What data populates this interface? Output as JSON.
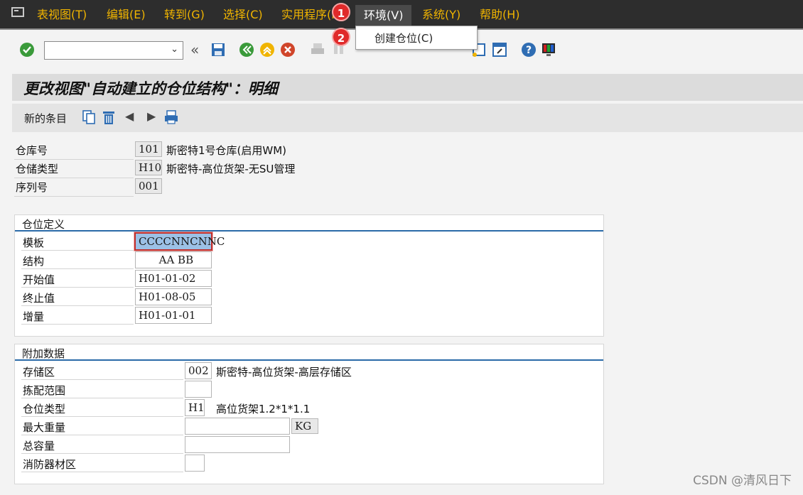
{
  "menu": {
    "items": [
      "表视图(T)",
      "编辑(E)",
      "转到(G)",
      "选择(C)",
      "实用程序(M)",
      "环境(V)",
      "系统(Y)",
      "帮助(H)"
    ],
    "active_index": 5,
    "dropdown": {
      "item": "创建仓位(C)"
    },
    "badges": [
      "1",
      "2"
    ]
  },
  "title": "更改视图\"自动建立的仓位结构\"：明细",
  "app_toolbar": {
    "new_entries": "新的条目"
  },
  "header": {
    "warehouse": {
      "label": "仓库号",
      "value": "101",
      "desc": "斯密特1号仓库(启用WM)"
    },
    "storage_type": {
      "label": "仓储类型",
      "value": "H10",
      "desc": "斯密特-高位货架-无SU管理"
    },
    "sequence": {
      "label": "序列号",
      "value": "001"
    }
  },
  "bin_definition": {
    "title": "仓位定义",
    "template": {
      "label": "模板",
      "value": "CCCCNNCNNC"
    },
    "structure": {
      "label": "结构",
      "value": "      AA BB"
    },
    "start_value": {
      "label": "开始值",
      "value": "H01-01-02"
    },
    "end_value": {
      "label": "终止值",
      "value": "H01-08-05"
    },
    "increment": {
      "label": "增量",
      "value": "H01-01-01"
    }
  },
  "additional": {
    "title": "附加数据",
    "storage_section": {
      "label": "存储区",
      "value": "002",
      "desc": "斯密特-高位货架-高层存储区"
    },
    "picking_area": {
      "label": "拣配范围",
      "value": ""
    },
    "bin_type": {
      "label": "仓位类型",
      "value": "H1",
      "desc": "高位货架1.2*1*1.1"
    },
    "max_weight": {
      "label": "最大重量",
      "value": "",
      "unit": "KG"
    },
    "total_capacity": {
      "label": "总容量",
      "value": ""
    },
    "fire_area": {
      "label": "消防器材区",
      "value": ""
    }
  },
  "watermark": "CSDN @清风日下",
  "icons": [
    "check-icon",
    "back-icon",
    "save-icon",
    "exit-icon",
    "cancel-icon",
    "print-icon",
    "find-icon",
    "help-icon",
    "layout-icon",
    "copy-icon",
    "delete-icon",
    "prev-icon",
    "next-icon"
  ]
}
